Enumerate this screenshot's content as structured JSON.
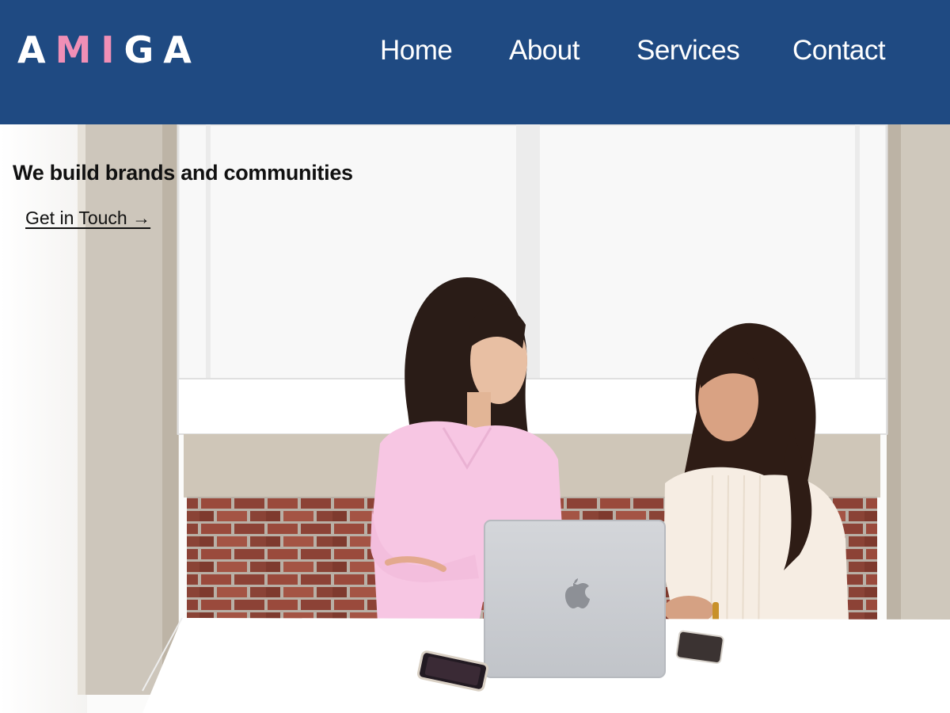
{
  "brand": {
    "letters": [
      "A",
      "M",
      "I",
      "G",
      "A"
    ],
    "letter_colors": [
      "#ffffff",
      "#f08fb6",
      "#f08fb6",
      "#ffffff",
      "#ffffff"
    ],
    "header_color": "#1f4a82"
  },
  "nav": {
    "items": [
      {
        "label": "Home"
      },
      {
        "label": "About"
      },
      {
        "label": "Services"
      },
      {
        "label": "Contact"
      }
    ]
  },
  "hero": {
    "headline": "We build brands and communities",
    "cta_label": "Get in Touch →",
    "image_description_icon": "two-women-laptop-photo"
  }
}
